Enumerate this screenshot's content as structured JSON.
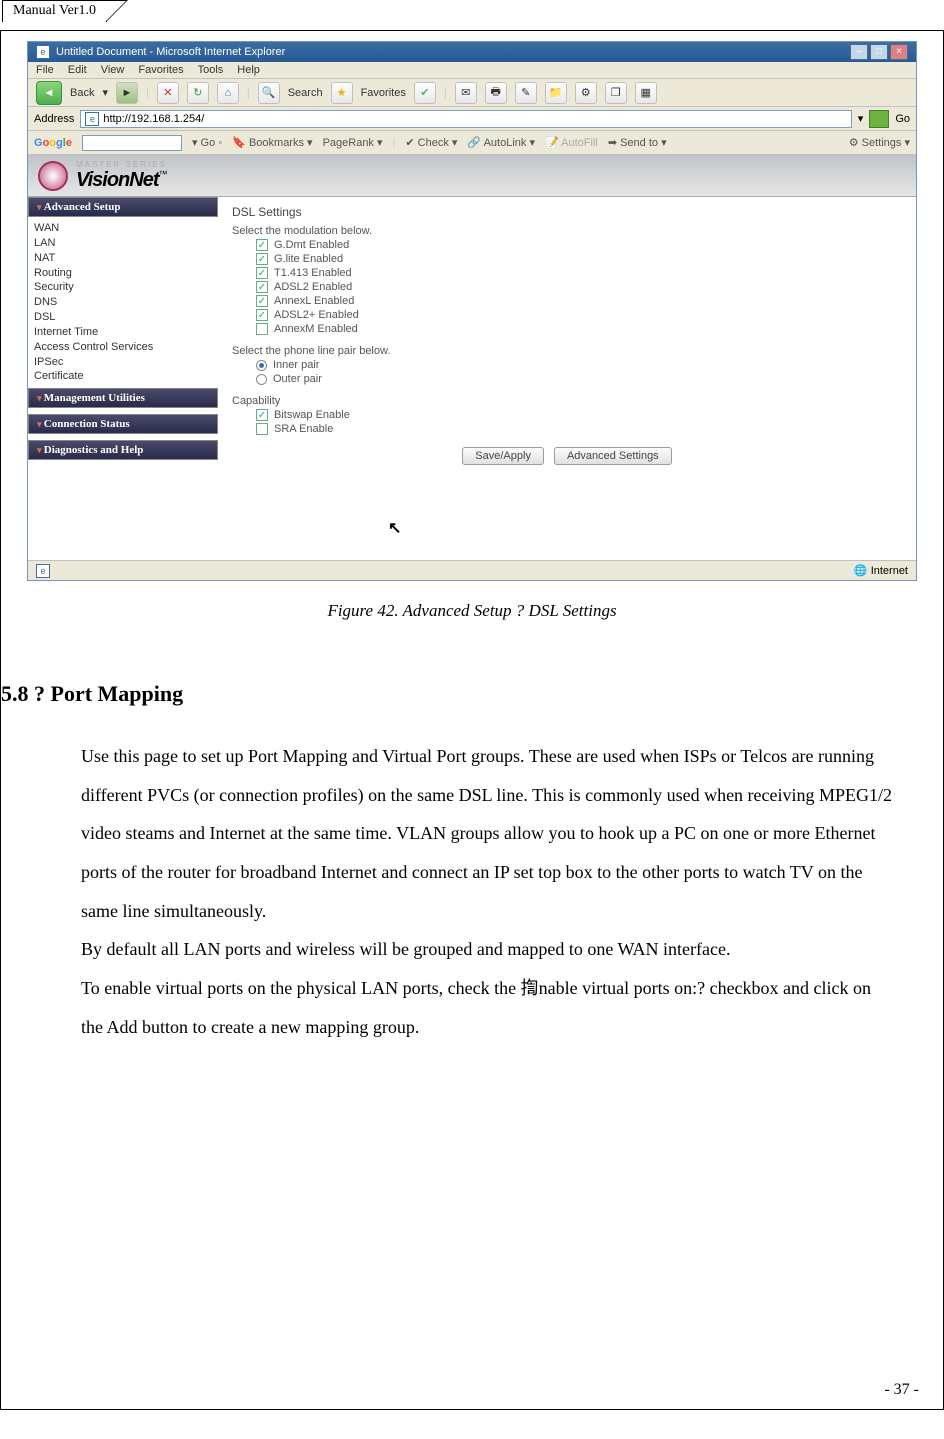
{
  "header_tab": "Manual Ver1.0",
  "screenshot": {
    "window_title": "Untitled Document - Microsoft Internet Explorer",
    "menu": [
      "File",
      "Edit",
      "View",
      "Favorites",
      "Tools",
      "Help"
    ],
    "toolbar": {
      "back": "Back",
      "search": "Search",
      "favorites": "Favorites"
    },
    "address_label": "Address",
    "address_url": "http://192.168.1.254/",
    "go": "Go",
    "google": {
      "label": "Google",
      "go": "Go",
      "bookmarks": "Bookmarks",
      "pagerank": "PageRank",
      "check": "Check",
      "autolink": "AutoLink",
      "autofill": "AutoFill",
      "sendto": "Send to",
      "settings": "Settings"
    },
    "brand_master": "MASTER SERIES",
    "brand": "VisionNet",
    "sidebar": {
      "adv": "Advanced Setup",
      "links": [
        "WAN",
        "LAN",
        "NAT",
        "Routing",
        "Security",
        "DNS",
        "DSL",
        "Internet Time",
        "Access Control Services",
        "IPSec",
        "Certificate"
      ],
      "mgmt": "Management Utilities",
      "conn": "Connection Status",
      "diag": "Diagnostics and Help"
    },
    "content": {
      "title": "DSL Settings",
      "mod_label": "Select the modulation below.",
      "mods": [
        {
          "label": "G.Dmt Enabled",
          "checked": true
        },
        {
          "label": "G.lite Enabled",
          "checked": true
        },
        {
          "label": "T1.413 Enabled",
          "checked": true
        },
        {
          "label": "ADSL2 Enabled",
          "checked": true
        },
        {
          "label": "AnnexL Enabled",
          "checked": true
        },
        {
          "label": "ADSL2+ Enabled",
          "checked": true
        },
        {
          "label": "AnnexM Enabled",
          "checked": false
        }
      ],
      "pair_label": "Select the phone line pair below.",
      "pairs": [
        {
          "label": "Inner pair",
          "checked": true
        },
        {
          "label": "Outer pair",
          "checked": false
        }
      ],
      "cap_label": "Capability",
      "caps": [
        {
          "label": "Bitswap Enable",
          "checked": true
        },
        {
          "label": "SRA Enable",
          "checked": false
        }
      ],
      "btn_save": "Save/Apply",
      "btn_adv": "Advanced Settings"
    },
    "status_internet": "Internet"
  },
  "caption": "Figure 42. Advanced Setup ? DSL Settings",
  "section": {
    "heading": "5.8 ? Port Mapping",
    "p1": "Use this page to set up Port Mapping and Virtual Port groups. These are used when ISPs or Telcos are running different PVCs (or connection profiles) on the same DSL line. This is commonly used when receiving MPEG1/2 video steams and Internet at the same time. VLAN groups allow you to hook up a PC on one or more Ethernet ports of the router for broadband Internet and connect an IP set top box to the other ports to watch TV on the same line simultaneously.",
    "p2": "By default all LAN ports and wireless will be grouped and mapped to one WAN interface.",
    "p3": "To enable virtual ports on the physical LAN ports, check the 揈nable virtual ports on:? checkbox and click on the Add button to create a new mapping group."
  },
  "page_number": "- 37 -"
}
